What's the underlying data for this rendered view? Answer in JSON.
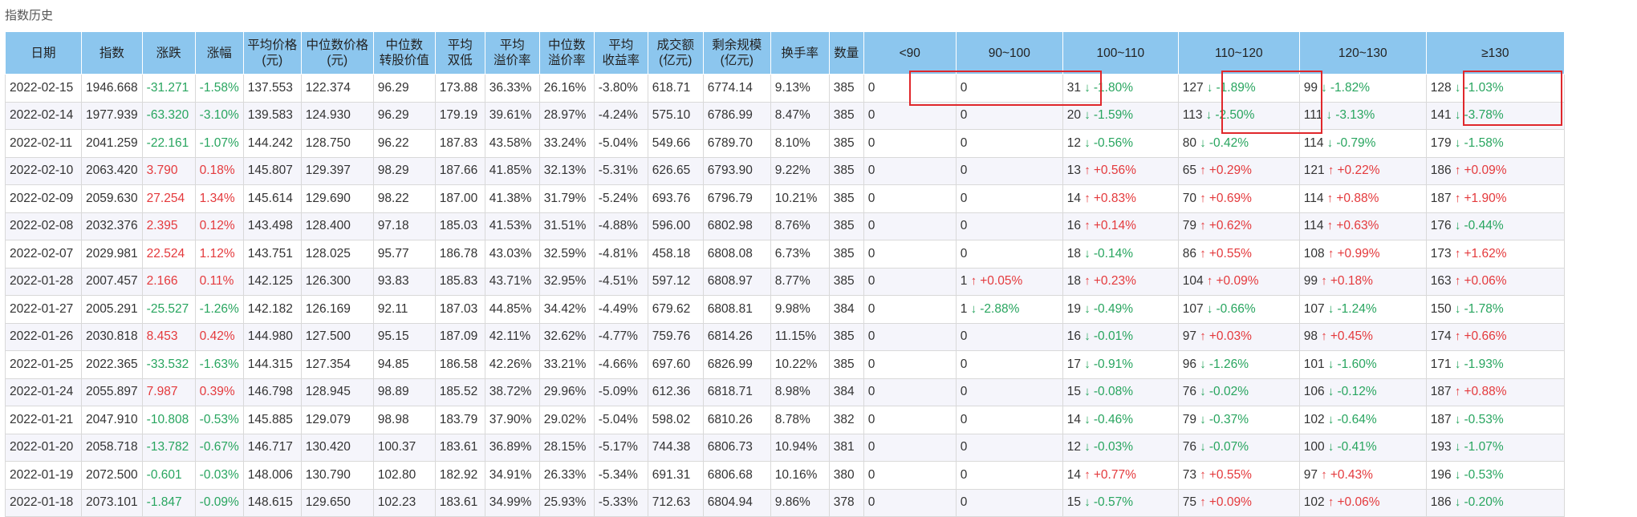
{
  "page": {
    "title": "指数历史"
  },
  "colors": {
    "up": "#e4393c",
    "down": "#28a55f",
    "header_bg": "#8cc6ee",
    "highlight": "#e0272b"
  },
  "table": {
    "headers": [
      {
        "l1": "日期",
        "l2": ""
      },
      {
        "l1": "指数",
        "l2": ""
      },
      {
        "l1": "涨跌",
        "l2": ""
      },
      {
        "l1": "涨幅",
        "l2": ""
      },
      {
        "l1": "平均价格",
        "l2": "(元)"
      },
      {
        "l1": "中位数价格",
        "l2": "(元)"
      },
      {
        "l1": "中位数",
        "l2": "转股价值"
      },
      {
        "l1": "平均",
        "l2": "双低"
      },
      {
        "l1": "平均",
        "l2": "溢价率"
      },
      {
        "l1": "中位数",
        "l2": "溢价率"
      },
      {
        "l1": "平均",
        "l2": "收益率"
      },
      {
        "l1": "成交额",
        "l2": "(亿元)"
      },
      {
        "l1": "剩余规模",
        "l2": "(亿元)"
      },
      {
        "l1": "换手率",
        "l2": ""
      },
      {
        "l1": "数量",
        "l2": ""
      },
      {
        "l1": "<90",
        "l2": ""
      },
      {
        "l1": "90~100",
        "l2": ""
      },
      {
        "l1": "100~110",
        "l2": ""
      },
      {
        "l1": "110~120",
        "l2": ""
      },
      {
        "l1": "120~130",
        "l2": ""
      },
      {
        "l1": "≥130",
        "l2": ""
      }
    ],
    "rows": [
      {
        "date": "2022-02-15",
        "index": "1946.668",
        "chg": "-31.271",
        "pct": "-1.58%",
        "avg_price": "137.553",
        "med_price": "122.374",
        "med_conv": "96.29",
        "avg_double": "173.88",
        "avg_prem": "36.33%",
        "med_prem": "26.16%",
        "avg_yield": "-3.80%",
        "turnover": "618.71",
        "remain": "6774.14",
        "turn_rate": "9.13%",
        "count": "385",
        "b": [
          {
            "n": "0",
            "p": ""
          },
          {
            "n": "0",
            "p": ""
          },
          {
            "n": "31",
            "p": "-1.80%"
          },
          {
            "n": "127",
            "p": "-1.89%"
          },
          {
            "n": "99",
            "p": "-1.82%"
          },
          {
            "n": "128",
            "p": "-1.03%"
          }
        ]
      },
      {
        "date": "2022-02-14",
        "index": "1977.939",
        "chg": "-63.320",
        "pct": "-3.10%",
        "avg_price": "139.583",
        "med_price": "124.930",
        "med_conv": "96.29",
        "avg_double": "179.19",
        "avg_prem": "39.61%",
        "med_prem": "28.97%",
        "avg_yield": "-4.24%",
        "turnover": "575.10",
        "remain": "6786.99",
        "turn_rate": "8.47%",
        "count": "385",
        "b": [
          {
            "n": "0",
            "p": ""
          },
          {
            "n": "0",
            "p": ""
          },
          {
            "n": "20",
            "p": "-1.59%"
          },
          {
            "n": "113",
            "p": "-2.50%"
          },
          {
            "n": "111",
            "p": "-3.13%"
          },
          {
            "n": "141",
            "p": "-3.78%"
          }
        ]
      },
      {
        "date": "2022-02-11",
        "index": "2041.259",
        "chg": "-22.161",
        "pct": "-1.07%",
        "avg_price": "144.242",
        "med_price": "128.750",
        "med_conv": "96.22",
        "avg_double": "187.83",
        "avg_prem": "43.58%",
        "med_prem": "33.24%",
        "avg_yield": "-5.04%",
        "turnover": "549.66",
        "remain": "6789.70",
        "turn_rate": "8.10%",
        "count": "385",
        "b": [
          {
            "n": "0",
            "p": ""
          },
          {
            "n": "0",
            "p": ""
          },
          {
            "n": "12",
            "p": "-0.56%"
          },
          {
            "n": "80",
            "p": "-0.42%"
          },
          {
            "n": "114",
            "p": "-0.79%"
          },
          {
            "n": "179",
            "p": "-1.58%"
          }
        ]
      },
      {
        "date": "2022-02-10",
        "index": "2063.420",
        "chg": "3.790",
        "pct": "0.18%",
        "avg_price": "145.807",
        "med_price": "129.397",
        "med_conv": "98.29",
        "avg_double": "187.66",
        "avg_prem": "41.85%",
        "med_prem": "32.13%",
        "avg_yield": "-5.31%",
        "turnover": "626.65",
        "remain": "6793.90",
        "turn_rate": "9.22%",
        "count": "385",
        "b": [
          {
            "n": "0",
            "p": ""
          },
          {
            "n": "0",
            "p": ""
          },
          {
            "n": "13",
            "p": "+0.56%"
          },
          {
            "n": "65",
            "p": "+0.29%"
          },
          {
            "n": "121",
            "p": "+0.22%"
          },
          {
            "n": "186",
            "p": "+0.09%"
          }
        ]
      },
      {
        "date": "2022-02-09",
        "index": "2059.630",
        "chg": "27.254",
        "pct": "1.34%",
        "avg_price": "145.614",
        "med_price": "129.690",
        "med_conv": "98.22",
        "avg_double": "187.00",
        "avg_prem": "41.38%",
        "med_prem": "31.79%",
        "avg_yield": "-5.24%",
        "turnover": "693.76",
        "remain": "6796.79",
        "turn_rate": "10.21%",
        "count": "385",
        "b": [
          {
            "n": "0",
            "p": ""
          },
          {
            "n": "0",
            "p": ""
          },
          {
            "n": "14",
            "p": "+0.83%"
          },
          {
            "n": "70",
            "p": "+0.69%"
          },
          {
            "n": "114",
            "p": "+0.88%"
          },
          {
            "n": "187",
            "p": "+1.90%"
          }
        ]
      },
      {
        "date": "2022-02-08",
        "index": "2032.376",
        "chg": "2.395",
        "pct": "0.12%",
        "avg_price": "143.498",
        "med_price": "128.400",
        "med_conv": "97.18",
        "avg_double": "185.03",
        "avg_prem": "41.53%",
        "med_prem": "31.51%",
        "avg_yield": "-4.88%",
        "turnover": "596.00",
        "remain": "6802.98",
        "turn_rate": "8.76%",
        "count": "385",
        "b": [
          {
            "n": "0",
            "p": ""
          },
          {
            "n": "0",
            "p": ""
          },
          {
            "n": "16",
            "p": "+0.14%"
          },
          {
            "n": "79",
            "p": "+0.62%"
          },
          {
            "n": "114",
            "p": "+0.63%"
          },
          {
            "n": "176",
            "p": "-0.44%"
          }
        ]
      },
      {
        "date": "2022-02-07",
        "index": "2029.981",
        "chg": "22.524",
        "pct": "1.12%",
        "avg_price": "143.751",
        "med_price": "128.025",
        "med_conv": "95.77",
        "avg_double": "186.78",
        "avg_prem": "43.03%",
        "med_prem": "32.59%",
        "avg_yield": "-4.81%",
        "turnover": "458.18",
        "remain": "6808.08",
        "turn_rate": "6.73%",
        "count": "385",
        "b": [
          {
            "n": "0",
            "p": ""
          },
          {
            "n": "0",
            "p": ""
          },
          {
            "n": "18",
            "p": "-0.14%"
          },
          {
            "n": "86",
            "p": "+0.55%"
          },
          {
            "n": "108",
            "p": "+0.99%"
          },
          {
            "n": "173",
            "p": "+1.62%"
          }
        ]
      },
      {
        "date": "2022-01-28",
        "index": "2007.457",
        "chg": "2.166",
        "pct": "0.11%",
        "avg_price": "142.125",
        "med_price": "126.300",
        "med_conv": "93.83",
        "avg_double": "185.83",
        "avg_prem": "43.71%",
        "med_prem": "32.95%",
        "avg_yield": "-4.51%",
        "turnover": "597.12",
        "remain": "6808.97",
        "turn_rate": "8.77%",
        "count": "385",
        "b": [
          {
            "n": "0",
            "p": ""
          },
          {
            "n": "1",
            "p": "+0.05%"
          },
          {
            "n": "18",
            "p": "+0.23%"
          },
          {
            "n": "104",
            "p": "+0.09%"
          },
          {
            "n": "99",
            "p": "+0.18%"
          },
          {
            "n": "163",
            "p": "+0.06%"
          }
        ]
      },
      {
        "date": "2022-01-27",
        "index": "2005.291",
        "chg": "-25.527",
        "pct": "-1.26%",
        "avg_price": "142.182",
        "med_price": "126.169",
        "med_conv": "92.11",
        "avg_double": "187.03",
        "avg_prem": "44.85%",
        "med_prem": "34.42%",
        "avg_yield": "-4.49%",
        "turnover": "679.62",
        "remain": "6808.81",
        "turn_rate": "9.98%",
        "count": "384",
        "b": [
          {
            "n": "0",
            "p": ""
          },
          {
            "n": "1",
            "p": "-2.88%"
          },
          {
            "n": "19",
            "p": "-0.49%"
          },
          {
            "n": "107",
            "p": "-0.66%"
          },
          {
            "n": "107",
            "p": "-1.24%"
          },
          {
            "n": "150",
            "p": "-1.78%"
          }
        ]
      },
      {
        "date": "2022-01-26",
        "index": "2030.818",
        "chg": "8.453",
        "pct": "0.42%",
        "avg_price": "144.980",
        "med_price": "127.500",
        "med_conv": "95.15",
        "avg_double": "187.09",
        "avg_prem": "42.11%",
        "med_prem": "32.62%",
        "avg_yield": "-4.77%",
        "turnover": "759.76",
        "remain": "6814.26",
        "turn_rate": "11.15%",
        "count": "385",
        "b": [
          {
            "n": "0",
            "p": ""
          },
          {
            "n": "0",
            "p": ""
          },
          {
            "n": "16",
            "p": "-0.01%"
          },
          {
            "n": "97",
            "p": "+0.03%"
          },
          {
            "n": "98",
            "p": "+0.45%"
          },
          {
            "n": "174",
            "p": "+0.66%"
          }
        ]
      },
      {
        "date": "2022-01-25",
        "index": "2022.365",
        "chg": "-33.532",
        "pct": "-1.63%",
        "avg_price": "144.315",
        "med_price": "127.354",
        "med_conv": "94.85",
        "avg_double": "186.58",
        "avg_prem": "42.26%",
        "med_prem": "33.21%",
        "avg_yield": "-4.66%",
        "turnover": "697.60",
        "remain": "6826.99",
        "turn_rate": "10.22%",
        "count": "385",
        "b": [
          {
            "n": "0",
            "p": ""
          },
          {
            "n": "0",
            "p": ""
          },
          {
            "n": "17",
            "p": "-0.91%"
          },
          {
            "n": "96",
            "p": "-1.26%"
          },
          {
            "n": "101",
            "p": "-1.60%"
          },
          {
            "n": "171",
            "p": "-1.93%"
          }
        ]
      },
      {
        "date": "2022-01-24",
        "index": "2055.897",
        "chg": "7.987",
        "pct": "0.39%",
        "avg_price": "146.798",
        "med_price": "128.945",
        "med_conv": "98.89",
        "avg_double": "185.52",
        "avg_prem": "38.72%",
        "med_prem": "29.96%",
        "avg_yield": "-5.09%",
        "turnover": "612.36",
        "remain": "6818.71",
        "turn_rate": "8.98%",
        "count": "384",
        "b": [
          {
            "n": "0",
            "p": ""
          },
          {
            "n": "0",
            "p": ""
          },
          {
            "n": "15",
            "p": "-0.08%"
          },
          {
            "n": "76",
            "p": "-0.02%"
          },
          {
            "n": "106",
            "p": "-0.12%"
          },
          {
            "n": "187",
            "p": "+0.88%"
          }
        ]
      },
      {
        "date": "2022-01-21",
        "index": "2047.910",
        "chg": "-10.808",
        "pct": "-0.53%",
        "avg_price": "145.885",
        "med_price": "129.079",
        "med_conv": "98.98",
        "avg_double": "183.79",
        "avg_prem": "37.90%",
        "med_prem": "29.02%",
        "avg_yield": "-5.04%",
        "turnover": "598.02",
        "remain": "6810.26",
        "turn_rate": "8.78%",
        "count": "382",
        "b": [
          {
            "n": "0",
            "p": ""
          },
          {
            "n": "0",
            "p": ""
          },
          {
            "n": "14",
            "p": "-0.46%"
          },
          {
            "n": "79",
            "p": "-0.37%"
          },
          {
            "n": "102",
            "p": "-0.64%"
          },
          {
            "n": "187",
            "p": "-0.53%"
          }
        ]
      },
      {
        "date": "2022-01-20",
        "index": "2058.718",
        "chg": "-13.782",
        "pct": "-0.67%",
        "avg_price": "146.717",
        "med_price": "130.420",
        "med_conv": "100.37",
        "avg_double": "183.61",
        "avg_prem": "36.89%",
        "med_prem": "28.15%",
        "avg_yield": "-5.17%",
        "turnover": "744.38",
        "remain": "6806.73",
        "turn_rate": "10.94%",
        "count": "381",
        "b": [
          {
            "n": "0",
            "p": ""
          },
          {
            "n": "0",
            "p": ""
          },
          {
            "n": "12",
            "p": "-0.03%"
          },
          {
            "n": "76",
            "p": "-0.07%"
          },
          {
            "n": "100",
            "p": "-0.41%"
          },
          {
            "n": "193",
            "p": "-1.07%"
          }
        ]
      },
      {
        "date": "2022-01-19",
        "index": "2072.500",
        "chg": "-0.601",
        "pct": "-0.03%",
        "avg_price": "148.006",
        "med_price": "130.790",
        "med_conv": "102.80",
        "avg_double": "182.92",
        "avg_prem": "34.91%",
        "med_prem": "26.33%",
        "avg_yield": "-5.34%",
        "turnover": "691.31",
        "remain": "6806.68",
        "turn_rate": "10.16%",
        "count": "380",
        "b": [
          {
            "n": "0",
            "p": ""
          },
          {
            "n": "0",
            "p": ""
          },
          {
            "n": "14",
            "p": "+0.77%"
          },
          {
            "n": "73",
            "p": "+0.55%"
          },
          {
            "n": "97",
            "p": "+0.43%"
          },
          {
            "n": "196",
            "p": "-0.53%"
          }
        ]
      },
      {
        "date": "2022-01-18",
        "index": "2073.101",
        "chg": "-1.847",
        "pct": "-0.09%",
        "avg_price": "148.615",
        "med_price": "129.650",
        "med_conv": "102.23",
        "avg_double": "183.61",
        "avg_prem": "34.99%",
        "med_prem": "25.93%",
        "avg_yield": "-5.33%",
        "turnover": "712.63",
        "remain": "6804.94",
        "turn_rate": "9.86%",
        "count": "378",
        "b": [
          {
            "n": "0",
            "p": ""
          },
          {
            "n": "0",
            "p": ""
          },
          {
            "n": "15",
            "p": "-0.57%"
          },
          {
            "n": "75",
            "p": "+0.09%"
          },
          {
            "n": "102",
            "p": "+0.06%"
          },
          {
            "n": "186",
            "p": "-0.20%"
          }
        ]
      }
    ]
  }
}
